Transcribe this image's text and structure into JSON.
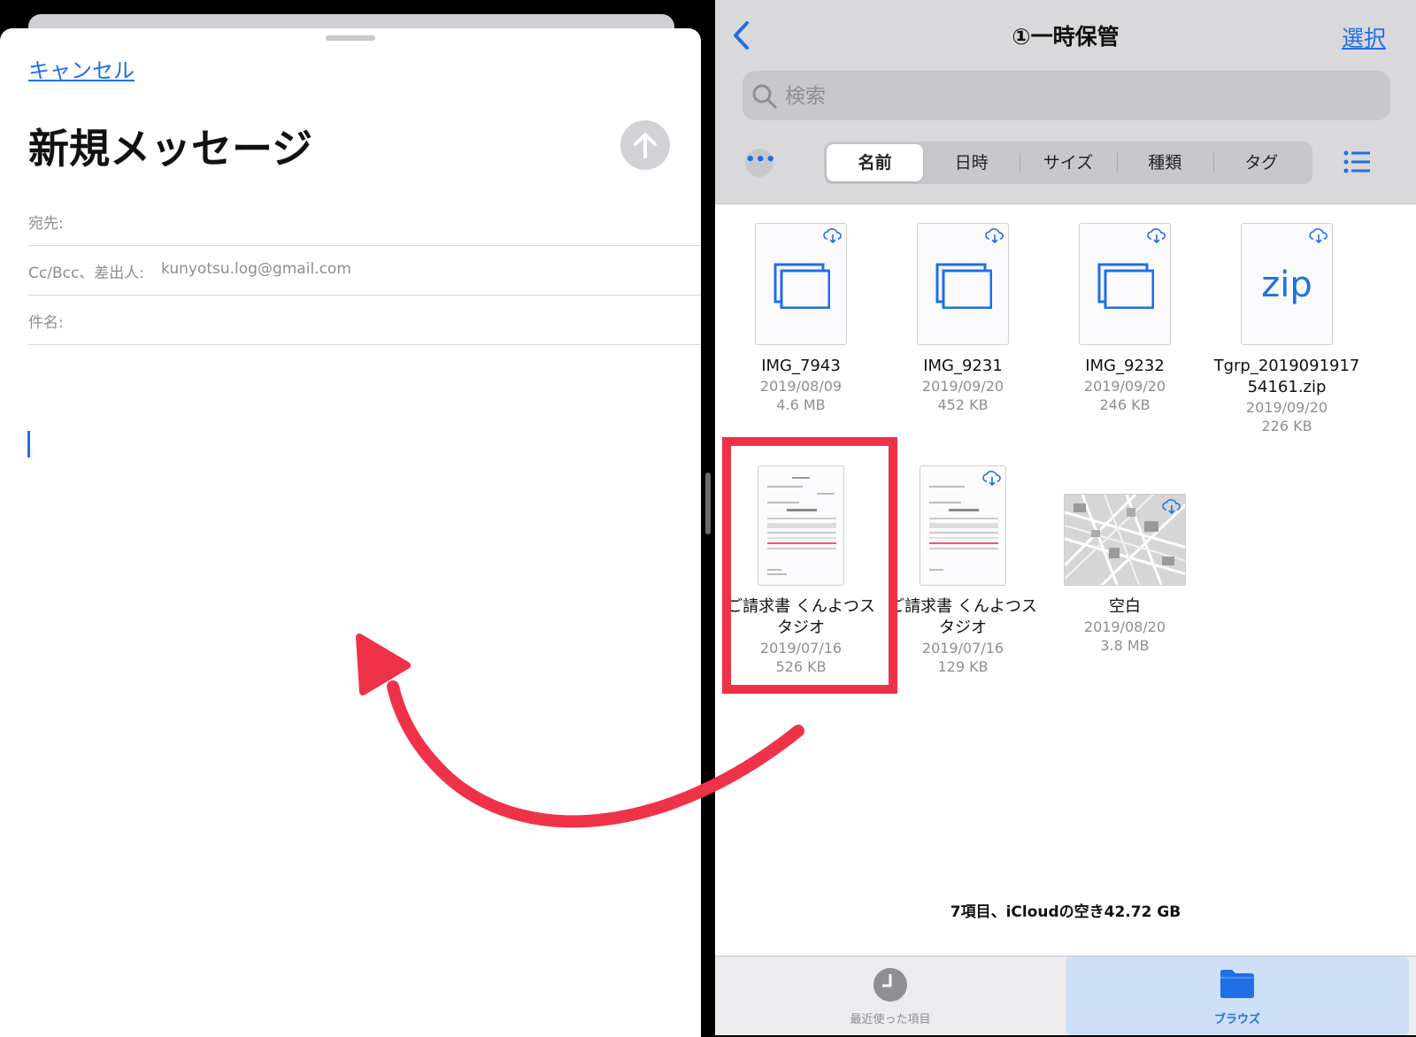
{
  "mail": {
    "cancel_label": "キャンセル",
    "title": "新規メッセージ",
    "to_label": "宛先:",
    "ccbcc_label": "Cc/Bcc、差出人:",
    "from_value": "kunyotsu.log@gmail.com",
    "subject_label": "件名:"
  },
  "files": {
    "title": "①一時保管",
    "select_label": "選択",
    "search_placeholder": "検索",
    "sort_tabs": [
      "名前",
      "日時",
      "サイズ",
      "種類",
      "タグ"
    ],
    "active_sort": "名前",
    "items": [
      {
        "name": "IMG_7943",
        "date": "2019/08/09",
        "size": "4.6 MB",
        "kind": "image"
      },
      {
        "name": "IMG_9231",
        "date": "2019/09/20",
        "size": "452 KB",
        "kind": "image"
      },
      {
        "name": "IMG_9232",
        "date": "2019/09/20",
        "size": "246 KB",
        "kind": "image"
      },
      {
        "name": "Tgrp_2019091917\n54161.zip",
        "date": "2019/09/20",
        "size": "226 KB",
        "kind": "zip",
        "icon_text": "zip"
      },
      {
        "name": "ご請求書 くんよつス\nタジオ",
        "date": "2019/07/16",
        "size": "526 KB",
        "kind": "document"
      },
      {
        "name": "ご請求書 くんよつス\nタジオ",
        "date": "2019/07/16",
        "size": "129 KB",
        "kind": "document"
      },
      {
        "name": "空白",
        "date": "2019/08/20",
        "size": "3.8 MB",
        "kind": "map"
      }
    ],
    "status": "7項目、iCloudの空き42.72 GB",
    "tabbar": {
      "recent_label": "最近使った項目",
      "browse_label": "ブラウズ"
    }
  },
  "colors": {
    "accent": "#1f6fe6",
    "highlight": "#ef3248"
  }
}
